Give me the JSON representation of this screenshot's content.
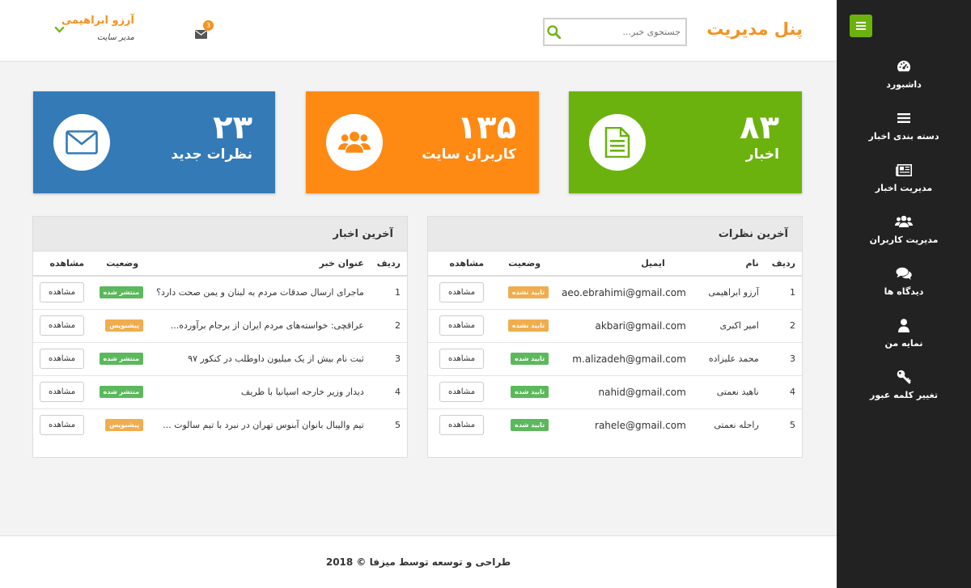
{
  "colors": {
    "green": "#6cb20e",
    "orange": "#fe8a14",
    "blue": "#337ab7",
    "sidebar": "#222222",
    "brand": "#f39323",
    "label_orange": "#f0ad4e",
    "label_green": "#5cb85c"
  },
  "header": {
    "brand": "پنل مدیریت",
    "search_placeholder": "جستجوی خبر...",
    "mail_count": "3",
    "user_name": "آرزو ابراهیمی",
    "user_role": "مدیر سایت"
  },
  "sidebar": {
    "items": [
      {
        "label": "داشبورد",
        "icon": "dashboard-icon"
      },
      {
        "label": "دسته بندی اخبار",
        "icon": "list-icon"
      },
      {
        "label": "مدیریت اخبار",
        "icon": "newspaper-icon"
      },
      {
        "label": "مدیریت کاربران",
        "icon": "users-icon"
      },
      {
        "label": "دیدگاه ها",
        "icon": "comments-icon"
      },
      {
        "label": "نمایه من",
        "icon": "user-icon"
      },
      {
        "label": "تغییر کلمه عبور",
        "icon": "key-icon"
      }
    ]
  },
  "stats": {
    "news": {
      "value": "۸۳",
      "label": "اخبار"
    },
    "users": {
      "value": "۱۳۵",
      "label": "کاربران سایت"
    },
    "comments": {
      "value": "۲۳",
      "label": "نظرات جدید"
    }
  },
  "latest_comments": {
    "title": "آخرین نظرات",
    "columns": [
      "ردیف",
      "نام",
      "ایمیل",
      "وضعیت",
      "مشاهده"
    ],
    "rows": [
      {
        "row": "1",
        "name": "آرزو ابراهیمی",
        "email": "aeo.ebrahimi@gmail.com",
        "status": "تایید نشده",
        "action": "مشاهده"
      },
      {
        "row": "2",
        "name": "امیر اکبری",
        "email": "akbari@gmail.com",
        "status": "تایید نشده",
        "action": "مشاهده"
      },
      {
        "row": "3",
        "name": "محمد علیزاده",
        "email": "m.alizadeh@gmail.com",
        "status": "تایید شده",
        "action": "مشاهده"
      },
      {
        "row": "4",
        "name": "ناهید نعمتی",
        "email": "nahid@gmail.com",
        "status": "تایید شده",
        "action": "مشاهده"
      },
      {
        "row": "5",
        "name": "راحله نعمتی",
        "email": "rahele@gmail.com",
        "status": "تایید شده",
        "action": "مشاهده"
      }
    ]
  },
  "latest_news": {
    "title": "آخرین اخبار",
    "columns": [
      "ردیف",
      "عنوان خبر",
      "وضعیت",
      "مشاهده"
    ],
    "rows": [
      {
        "row": "1",
        "title": "ماجرای ارسال صدقات مردم به لبنان و یمن صحت دارد؟",
        "status": "منتشر شده",
        "action": "مشاهده"
      },
      {
        "row": "2",
        "title": "عراقچی: خواسته‌های مردم ایران از برجام برآورده...",
        "status": "پیشنویس",
        "action": "مشاهده"
      },
      {
        "row": "3",
        "title": "ثبت نام بیش از یک میلیون داوطلب در کنکور ۹۷",
        "status": "منتشر شده",
        "action": "مشاهده"
      },
      {
        "row": "4",
        "title": "دیدار وزیر خارجه اسپانیا با ظریف",
        "status": "منتشر شده",
        "action": "مشاهده"
      },
      {
        "row": "5",
        "title": "تیم والیبال بانوان آبنوس تهران در نبرد با تیم سالوت ...",
        "status": "پیشنویس",
        "action": "مشاهده"
      }
    ]
  },
  "footer": {
    "text": "طراحی و توسعه توسط میزفا © 2018"
  }
}
